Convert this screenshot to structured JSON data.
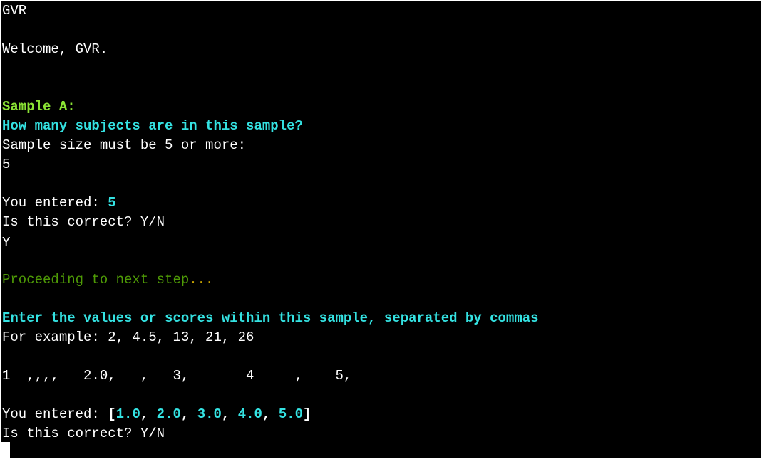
{
  "colors": {
    "background": "#000000",
    "text": "#ffffff",
    "heading_green": "#8ae234",
    "prompt_cyan": "#34e2e2",
    "status_green": "#4e9a06",
    "status_ellipsis": "#c4a000"
  },
  "terminal": {
    "user_line": "GVR",
    "welcome": "Welcome, GVR.",
    "sample_heading": "Sample A:",
    "size_question": "How many subjects are in this sample?",
    "size_rule": "Sample size must be 5 or more:",
    "size_input": "5",
    "size_confirm": {
      "label": "You entered: ",
      "value": "5"
    },
    "confirm_question_1": "Is this correct? Y/N",
    "confirm_answer_1": "Y",
    "proceeding": {
      "text": "Proceeding to next step",
      "ellipsis": "..."
    },
    "values_prompt": "Enter the values or scores within this sample, separated by commas",
    "values_example": "For example: 2, 4.5, 13, 21, 26",
    "values_input": "1  ,,,,   2.0,   ,   3,       4     ,    5,",
    "values_confirm": {
      "label": "You entered: ",
      "open_bracket": "[",
      "close_bracket": "]",
      "separator": ", ",
      "values": [
        "1.0",
        "2.0",
        "3.0",
        "4.0",
        "5.0"
      ]
    },
    "confirm_question_2": "Is this correct? Y/N"
  }
}
